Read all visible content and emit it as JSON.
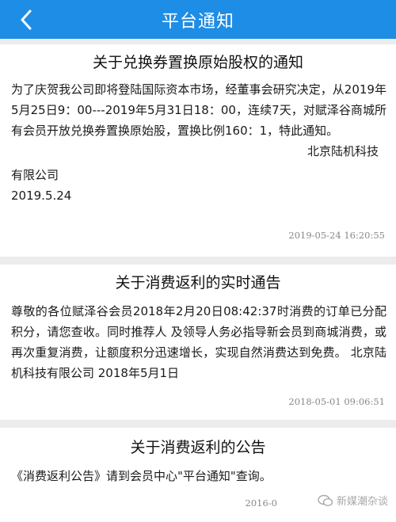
{
  "header": {
    "title": "平台通知",
    "back_icon": "chevron-left-icon"
  },
  "notices": [
    {
      "title": "关于兑换券置换原始股权的通知",
      "body": "为了庆贺我公司即将登陆国际资本市场，经董事会研究决定，从2019年5月25日9：00---2019年5月31日18：00，连续7天，对赋泽谷商城所有会员开放兑换券置换原始股，置换比例160：1，特此通知。",
      "signature": "北京陆机科技",
      "signature_cont": "有限公司",
      "date_line": " 2019.5.24",
      "timestamp": "2019-05-24 16:20:55"
    },
    {
      "title": "关于消费返利的实时通告",
      "body": "尊敬的各位赋泽谷会员2018年2月20日08:42:37时消费的订单已分配积分，请您查收。同时推荐人 及领导人务必指导新会员到商城消费，或再次重复消费，让额度积分迅速增长，实现自然消费达到免费。 北京陆机科技有限公司 2018年5月1日",
      "timestamp": "2018-05-01 09:06:51"
    },
    {
      "title": "关于消费返利的公告",
      "body": "《消费返利公告》请到会员中心\"平台通知\"查询。",
      "timestamp": "2016-0"
    }
  ],
  "watermark": {
    "text": "新媒潮杂谈",
    "icon": "wechat-logo-icon"
  },
  "colors": {
    "header_bg": "#1e8de6",
    "page_bg": "#ececec",
    "card_bg": "#ffffff",
    "timestamp": "#888888"
  }
}
